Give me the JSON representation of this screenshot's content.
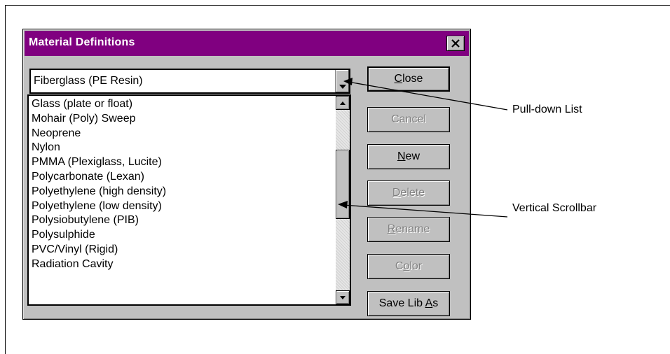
{
  "dialog": {
    "title": "Material Definitions",
    "close_glyph": "✕",
    "combo": {
      "value": "Fiberglass (PE Resin)"
    },
    "list": {
      "items": [
        "Glass (plate or float)",
        "Mohair (Poly) Sweep",
        "Neoprene",
        "Nylon",
        "PMMA (Plexiglass, Lucite)",
        "Polycarbonate (Lexan)",
        "Polyethylene (high density)",
        "Polyethylene (low density)",
        "Polysiobutylene (PIB)",
        "Polysulphide",
        "PVC/Vinyl (Rigid)",
        "Radiation Cavity"
      ]
    },
    "buttons": {
      "close": {
        "pre": "",
        "acc": "C",
        "post": "lose"
      },
      "cancel": {
        "pre": "Cancel",
        "acc": "",
        "post": ""
      },
      "new": {
        "pre": "",
        "acc": "N",
        "post": "ew"
      },
      "delete": {
        "pre": "",
        "acc": "D",
        "post": "elete"
      },
      "rename": {
        "pre": "",
        "acc": "R",
        "post": "ename"
      },
      "color": {
        "pre": "C",
        "acc": "o",
        "post": "lor"
      },
      "save_lib_as": {
        "pre": "Save Lib ",
        "acc": "A",
        "post": "s"
      }
    }
  },
  "callouts": {
    "pulldown": "Pull-down List",
    "scrollbar": "Vertical Scrollbar"
  },
  "icons": {
    "close": "close-icon",
    "dropdown": "chevron-down-icon",
    "scroll_up": "arrow-up-icon",
    "scroll_down": "arrow-down-icon"
  },
  "colors": {
    "titlebar": "#800080",
    "face": "#c0c0c0"
  }
}
